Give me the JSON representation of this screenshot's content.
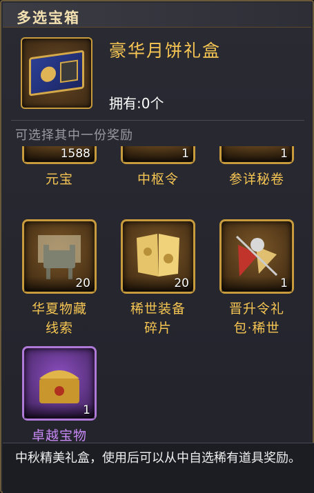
{
  "title": "多选宝箱",
  "header_item": {
    "name": "豪华月饼礼盒",
    "owned": "拥有:0个",
    "icon": "blue-gift-box-icon"
  },
  "section_label": "可选择其中一份奖励",
  "rewards": [
    {
      "label": "元宝",
      "qty": "1588",
      "icon": "gold-ingot-icon",
      "rarity": "gold"
    },
    {
      "label": "中枢令",
      "qty": "1",
      "icon": "token-icon",
      "rarity": "gold"
    },
    {
      "label": "参详秘卷",
      "qty": "1",
      "icon": "scroll-icon",
      "rarity": "gold"
    },
    {
      "label": "华夏物藏线索",
      "qty": "20",
      "icon": "bronze-cauldron-icon",
      "rarity": "gold"
    },
    {
      "label": "稀世装备碎片",
      "qty": "20",
      "icon": "equipment-shard-icon",
      "rarity": "gold"
    },
    {
      "label": "晋升令礼包·稀世",
      "qty": "1",
      "icon": "promotion-pack-icon",
      "rarity": "gold"
    },
    {
      "label": "卓越宝物",
      "qty": "1",
      "icon": "treasure-chest-icon",
      "rarity": "purple"
    }
  ],
  "description": "中秋精美礼盒，使用后可以从中自选稀有道具奖励。",
  "colors": {
    "gold": "#c89b3c",
    "purple": "#b07ad8",
    "label_gold": "#f7c653",
    "label_purple": "#c98af5"
  }
}
